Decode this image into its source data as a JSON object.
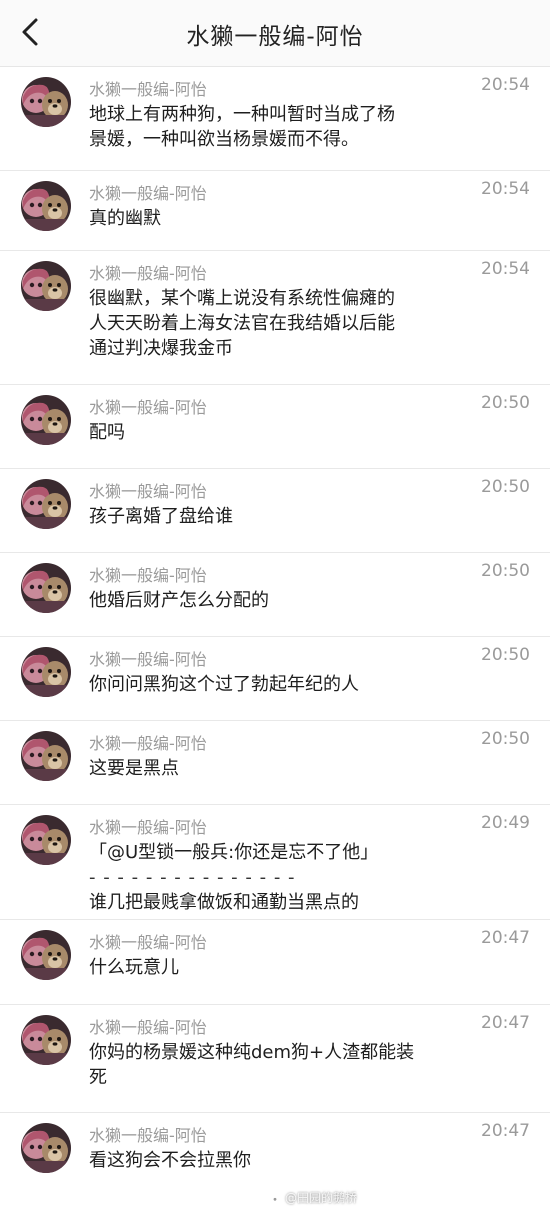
{
  "header": {
    "title": "水獭一般编-阿怡",
    "back_icon": "chevron-left-icon"
  },
  "messages": [
    {
      "name": "水獭一般编-阿怡",
      "time": "20:54",
      "lines": [
        "地球上有两种狗，一种叫暂时当成了杨",
        "景媛，一种叫欲当杨景媛而不得。"
      ]
    },
    {
      "name": "水獭一般编-阿怡",
      "time": "20:54",
      "lines": [
        "真的幽默"
      ]
    },
    {
      "name": "水獭一般编-阿怡",
      "time": "20:54",
      "lines": [
        "很幽默，某个嘴上说没有系统性偏瘫的",
        "人天天盼着上海女法官在我结婚以后能",
        "通过判决爆我金币"
      ]
    },
    {
      "name": "水獭一般编-阿怡",
      "time": "20:50",
      "lines": [
        "配吗"
      ]
    },
    {
      "name": "水獭一般编-阿怡",
      "time": "20:50",
      "lines": [
        "孩子离婚了盘给谁"
      ]
    },
    {
      "name": "水獭一般编-阿怡",
      "time": "20:50",
      "lines": [
        "他婚后财产怎么分配的"
      ]
    },
    {
      "name": "水獭一般编-阿怡",
      "time": "20:50",
      "lines": [
        "你问问黑狗这个过了勃起年纪的人"
      ]
    },
    {
      "name": "水獭一般编-阿怡",
      "time": "20:50",
      "lines": [
        "这要是黑点"
      ]
    },
    {
      "name": "水獭一般编-阿怡",
      "time": "20:49",
      "lines": [
        "「@U型锁一般兵:你还是忘不了他」",
        "- - - - - - - - - - - - - - -",
        "谁几把最贱拿做饭和通勤当黑点的"
      ]
    },
    {
      "name": "水獭一般编-阿怡",
      "time": "20:47",
      "lines": [
        "什么玩意儿"
      ]
    },
    {
      "name": "水獭一般编-阿怡",
      "time": "20:47",
      "lines": [
        "你妈的杨景媛这种纯dem狗+人渣都能装",
        "死"
      ]
    },
    {
      "name": "水獭一般编-阿怡",
      "time": "20:47",
      "lines": [
        "看这狗会不会拉黑你"
      ]
    }
  ],
  "watermark": {
    "text": "@田园的鹅桥",
    "icon": "weibo-icon"
  },
  "colors": {
    "header_bg": "#fafafa",
    "name_gray": "#9a9a9a",
    "text": "#1e1e1e",
    "divider": "#e8e8e8"
  }
}
